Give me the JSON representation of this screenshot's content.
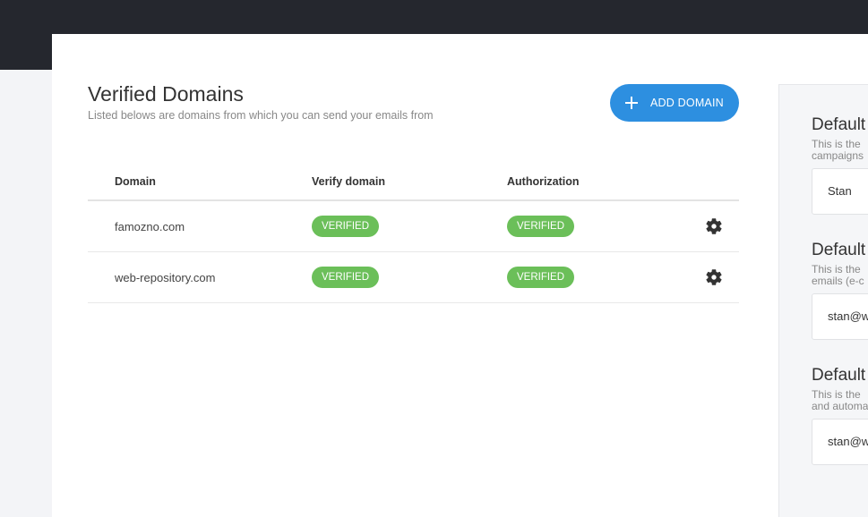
{
  "header": {
    "title": "Verified Domains",
    "subtitle": "Listed belows are domains from which you can send your emails from",
    "add_button": "ADD DOMAIN"
  },
  "table": {
    "columns": [
      "Domain",
      "Verify domain",
      "Authorization"
    ],
    "rows": [
      {
        "domain": "famozno.com",
        "verify": "VERIFIED",
        "authorization": "VERIFIED"
      },
      {
        "domain": "web-repository.com",
        "verify": "VERIFIED",
        "authorization": "VERIFIED"
      }
    ]
  },
  "sidebar": {
    "sections": [
      {
        "title": "Default",
        "desc_line1": "This is the",
        "desc_line2": "campaigns",
        "value": "Stan"
      },
      {
        "title": "Default",
        "desc_line1": "This is the",
        "desc_line2": "emails (e-c",
        "value": "stan@w"
      },
      {
        "title": "Default",
        "desc_line1": "This is the",
        "desc_line2": "and automa",
        "value": "stan@w"
      }
    ]
  },
  "colors": {
    "accent": "#2d8fe0",
    "verified": "#6bbf59",
    "topbar": "#25272e"
  },
  "icons": {
    "add": "plus-icon",
    "settings": "gear-icon"
  }
}
